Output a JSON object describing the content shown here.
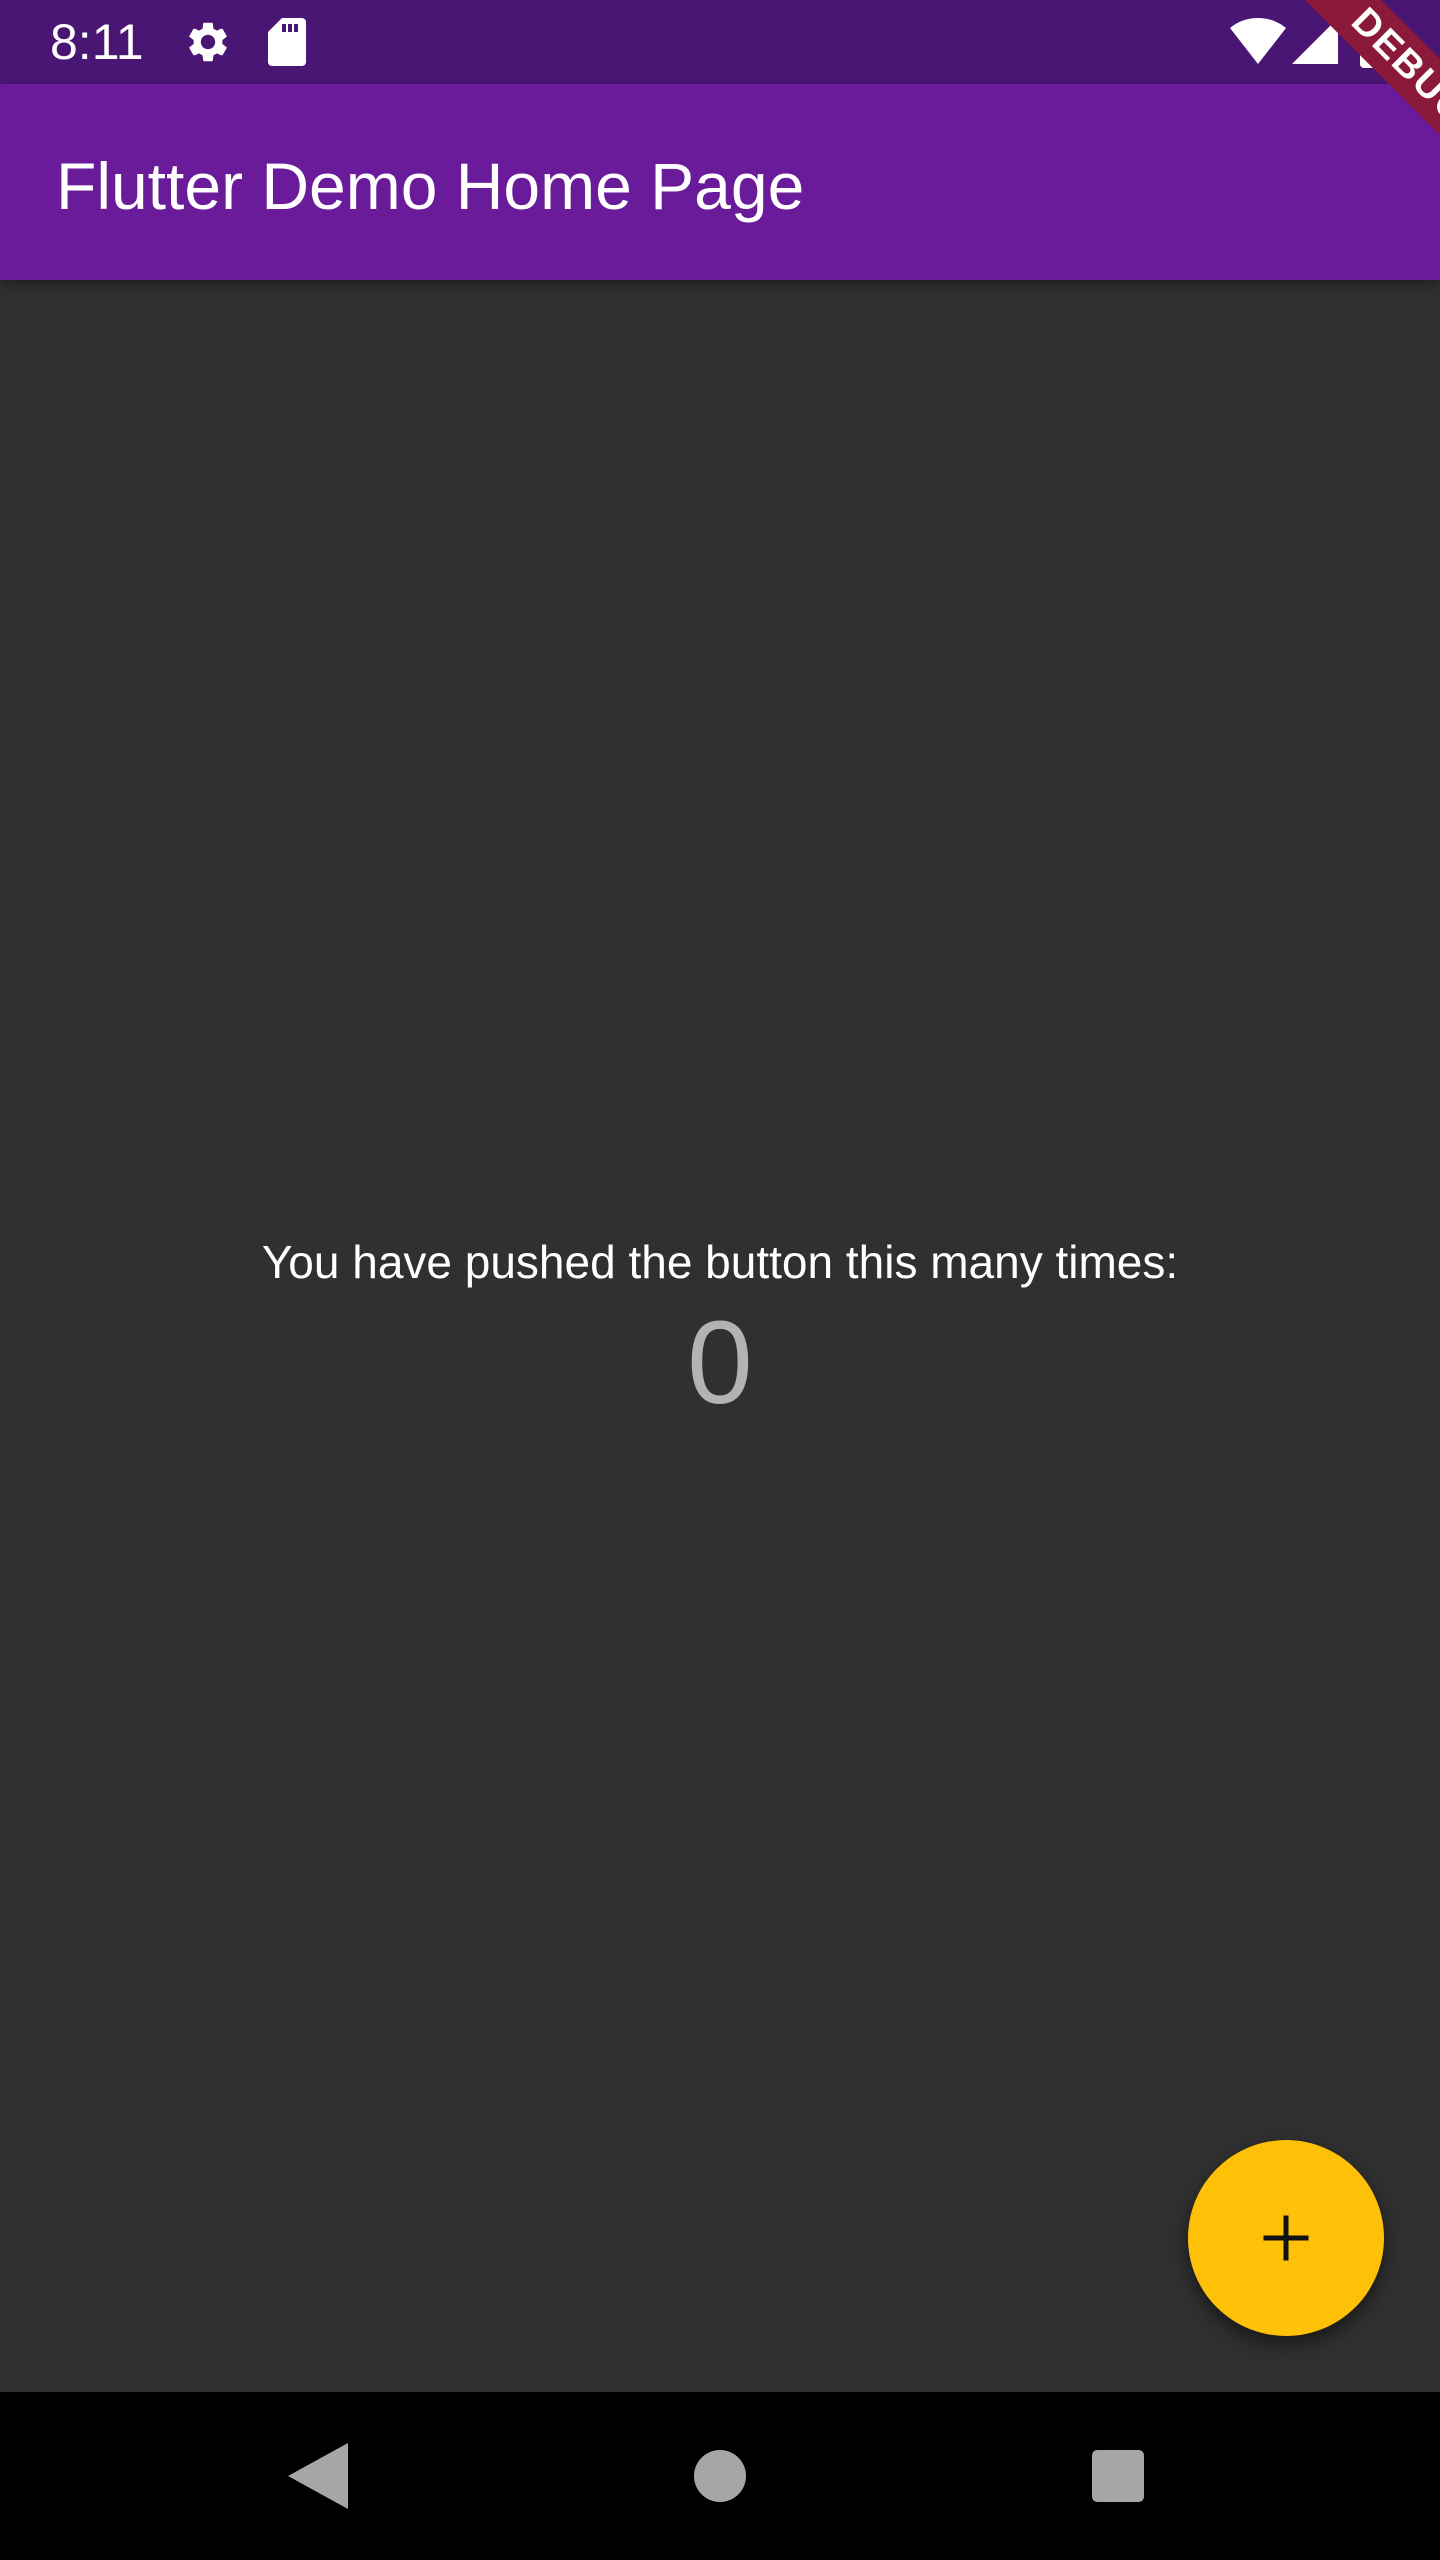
{
  "status_bar": {
    "time": "8:11",
    "icons": [
      "gear-icon",
      "sd-card-icon",
      "wifi-icon",
      "signal-icon",
      "battery-icon"
    ]
  },
  "debug_banner": {
    "label": "DEBUG"
  },
  "app_bar": {
    "title": "Flutter Demo Home Page"
  },
  "main": {
    "counter_label": "You have pushed the button this many times:",
    "counter_value": "0"
  },
  "fab": {
    "icon": "plus-icon"
  },
  "nav_bar": {
    "buttons": [
      "back-icon",
      "home-icon",
      "recents-icon"
    ]
  },
  "colors": {
    "status_bar": "#4a1674",
    "app_bar": "#6a1b9a",
    "background": "#303030",
    "fab": "#ffc107",
    "debug_ribbon": "#8b1a3a",
    "nav_bar": "#000000"
  }
}
